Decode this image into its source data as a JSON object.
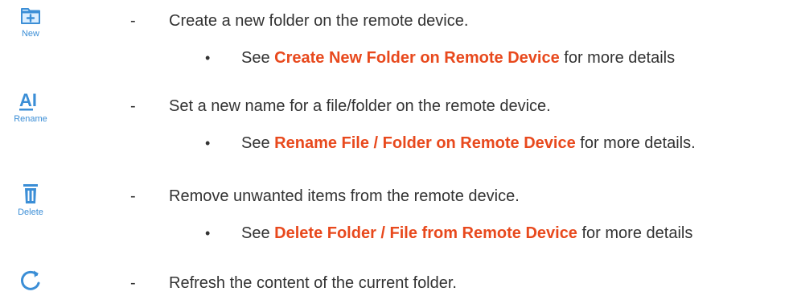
{
  "accent_color": "#3b8ed6",
  "link_color": "#e8491d",
  "rows": [
    {
      "icon": "new-folder-icon",
      "tool_label": "New",
      "dash": "-",
      "description": "Create a new folder on the remote device.",
      "bullet": "•",
      "see_prefix": "See ",
      "link": "Create New Folder on Remote Device",
      "see_suffix": " for more details"
    },
    {
      "icon": "rename-icon",
      "icon_text": "AI",
      "tool_label": "Rename",
      "dash": "-",
      "description": "Set a new name for a file/folder on the remote device.",
      "bullet": "•",
      "see_prefix": "See ",
      "link": "Rename File / Folder on Remote Device",
      "see_suffix": " for more details."
    },
    {
      "icon": "trash-icon",
      "tool_label": "Delete",
      "dash": "-",
      "description": "Remove unwanted items from the remote device.",
      "bullet": "•",
      "see_prefix": "See ",
      "link": "Delete Folder / File from Remote Device",
      "see_suffix": " for more details"
    },
    {
      "icon": "refresh-icon",
      "dash": "-",
      "description": "Refresh the content of the current folder."
    }
  ]
}
